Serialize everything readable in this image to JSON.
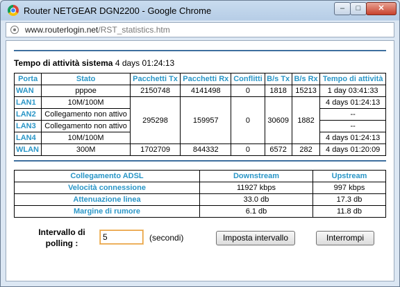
{
  "window": {
    "title": "Router NETGEAR DGN2200 - Google Chrome",
    "min": "–",
    "max": "□",
    "close": "✕"
  },
  "address": {
    "domain": "www.routerlogin.net",
    "path": "/RST_statistics.htm"
  },
  "uptime": {
    "label": "Tempo di attività sistema",
    "value": "4 days 01:24:13"
  },
  "stats": {
    "headers": [
      "Porta",
      "Stato",
      "Pacchetti Tx",
      "Pacchetti Rx",
      "Conflitti",
      "B/s Tx",
      "B/s Rx",
      "Tempo di attività"
    ],
    "wan": {
      "port": "WAN",
      "status": "pppoe",
      "tx": "2150748",
      "rx": "4141498",
      "coll": "0",
      "bstx": "1818",
      "bsrx": "15213",
      "uptime": "1 day 03:41:33"
    },
    "lan_shared": {
      "tx": "295298",
      "rx": "159957",
      "coll": "0",
      "bstx": "30609",
      "bsrx": "1882"
    },
    "lan": [
      {
        "port": "LAN1",
        "status": "10M/100M",
        "uptime": "4 days 01:24:13"
      },
      {
        "port": "LAN2",
        "status": "Collegamento non attivo",
        "uptime": "--"
      },
      {
        "port": "LAN3",
        "status": "Collegamento non attivo",
        "uptime": "--"
      },
      {
        "port": "LAN4",
        "status": "10M/100M",
        "uptime": "4 days 01:24:13"
      }
    ],
    "wlan": {
      "port": "WLAN",
      "status": "300M",
      "tx": "1702709",
      "rx": "844332",
      "coll": "0",
      "bstx": "6572",
      "bsrx": "282",
      "uptime": "4 days 01:20:09"
    }
  },
  "adsl": {
    "headers": [
      "Collegamento ADSL",
      "Downstream",
      "Upstream"
    ],
    "rows": [
      {
        "label": "Velocità connessione",
        "down": "11927 kbps",
        "up": "997 kbps"
      },
      {
        "label": "Attenuazione linea",
        "down": "33.0 db",
        "up": "17.3 db"
      },
      {
        "label": "Margine di rumore",
        "down": "6.1 db",
        "up": "11.8 db"
      }
    ]
  },
  "polling": {
    "label_line1": "Intervallo di",
    "label_line2": "polling :",
    "value": "5",
    "unit": "(secondi)"
  },
  "buttons": {
    "set": "Imposta intervallo",
    "stop": "Interrompi"
  }
}
